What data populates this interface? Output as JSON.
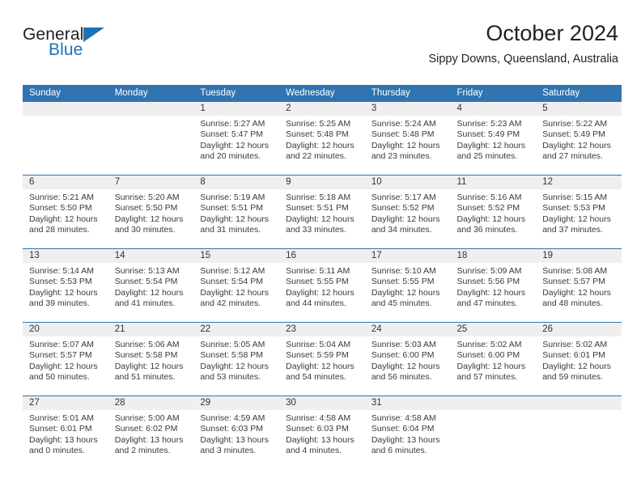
{
  "brand": {
    "line1": "General",
    "line2": "Blue",
    "triangle_color": "#1d72b8"
  },
  "header": {
    "title": "October 2024",
    "subtitle": "Sippy Downs, Queensland, Australia",
    "accent_color": "#3074b0",
    "band_color": "#efefef"
  },
  "weekday_headers": [
    "Sunday",
    "Monday",
    "Tuesday",
    "Wednesday",
    "Thursday",
    "Friday",
    "Saturday"
  ],
  "labels": {
    "sunrise_prefix": "Sunrise:",
    "sunset_prefix": "Sunset:",
    "daylight_prefix": "Daylight:"
  },
  "weeks": [
    [
      {
        "day": "",
        "sunrise": "",
        "sunset": "",
        "daylight": "",
        "empty": true
      },
      {
        "day": "",
        "sunrise": "",
        "sunset": "",
        "daylight": "",
        "empty": true
      },
      {
        "day": "1",
        "sunrise": "Sunrise: 5:27 AM",
        "sunset": "Sunset: 5:47 PM",
        "daylight": "Daylight: 12 hours and 20 minutes."
      },
      {
        "day": "2",
        "sunrise": "Sunrise: 5:25 AM",
        "sunset": "Sunset: 5:48 PM",
        "daylight": "Daylight: 12 hours and 22 minutes."
      },
      {
        "day": "3",
        "sunrise": "Sunrise: 5:24 AM",
        "sunset": "Sunset: 5:48 PM",
        "daylight": "Daylight: 12 hours and 23 minutes."
      },
      {
        "day": "4",
        "sunrise": "Sunrise: 5:23 AM",
        "sunset": "Sunset: 5:49 PM",
        "daylight": "Daylight: 12 hours and 25 minutes."
      },
      {
        "day": "5",
        "sunrise": "Sunrise: 5:22 AM",
        "sunset": "Sunset: 5:49 PM",
        "daylight": "Daylight: 12 hours and 27 minutes."
      }
    ],
    [
      {
        "day": "6",
        "sunrise": "Sunrise: 5:21 AM",
        "sunset": "Sunset: 5:50 PM",
        "daylight": "Daylight: 12 hours and 28 minutes."
      },
      {
        "day": "7",
        "sunrise": "Sunrise: 5:20 AM",
        "sunset": "Sunset: 5:50 PM",
        "daylight": "Daylight: 12 hours and 30 minutes."
      },
      {
        "day": "8",
        "sunrise": "Sunrise: 5:19 AM",
        "sunset": "Sunset: 5:51 PM",
        "daylight": "Daylight: 12 hours and 31 minutes."
      },
      {
        "day": "9",
        "sunrise": "Sunrise: 5:18 AM",
        "sunset": "Sunset: 5:51 PM",
        "daylight": "Daylight: 12 hours and 33 minutes."
      },
      {
        "day": "10",
        "sunrise": "Sunrise: 5:17 AM",
        "sunset": "Sunset: 5:52 PM",
        "daylight": "Daylight: 12 hours and 34 minutes."
      },
      {
        "day": "11",
        "sunrise": "Sunrise: 5:16 AM",
        "sunset": "Sunset: 5:52 PM",
        "daylight": "Daylight: 12 hours and 36 minutes."
      },
      {
        "day": "12",
        "sunrise": "Sunrise: 5:15 AM",
        "sunset": "Sunset: 5:53 PM",
        "daylight": "Daylight: 12 hours and 37 minutes."
      }
    ],
    [
      {
        "day": "13",
        "sunrise": "Sunrise: 5:14 AM",
        "sunset": "Sunset: 5:53 PM",
        "daylight": "Daylight: 12 hours and 39 minutes."
      },
      {
        "day": "14",
        "sunrise": "Sunrise: 5:13 AM",
        "sunset": "Sunset: 5:54 PM",
        "daylight": "Daylight: 12 hours and 41 minutes."
      },
      {
        "day": "15",
        "sunrise": "Sunrise: 5:12 AM",
        "sunset": "Sunset: 5:54 PM",
        "daylight": "Daylight: 12 hours and 42 minutes."
      },
      {
        "day": "16",
        "sunrise": "Sunrise: 5:11 AM",
        "sunset": "Sunset: 5:55 PM",
        "daylight": "Daylight: 12 hours and 44 minutes."
      },
      {
        "day": "17",
        "sunrise": "Sunrise: 5:10 AM",
        "sunset": "Sunset: 5:55 PM",
        "daylight": "Daylight: 12 hours and 45 minutes."
      },
      {
        "day": "18",
        "sunrise": "Sunrise: 5:09 AM",
        "sunset": "Sunset: 5:56 PM",
        "daylight": "Daylight: 12 hours and 47 minutes."
      },
      {
        "day": "19",
        "sunrise": "Sunrise: 5:08 AM",
        "sunset": "Sunset: 5:57 PM",
        "daylight": "Daylight: 12 hours and 48 minutes."
      }
    ],
    [
      {
        "day": "20",
        "sunrise": "Sunrise: 5:07 AM",
        "sunset": "Sunset: 5:57 PM",
        "daylight": "Daylight: 12 hours and 50 minutes."
      },
      {
        "day": "21",
        "sunrise": "Sunrise: 5:06 AM",
        "sunset": "Sunset: 5:58 PM",
        "daylight": "Daylight: 12 hours and 51 minutes."
      },
      {
        "day": "22",
        "sunrise": "Sunrise: 5:05 AM",
        "sunset": "Sunset: 5:58 PM",
        "daylight": "Daylight: 12 hours and 53 minutes."
      },
      {
        "day": "23",
        "sunrise": "Sunrise: 5:04 AM",
        "sunset": "Sunset: 5:59 PM",
        "daylight": "Daylight: 12 hours and 54 minutes."
      },
      {
        "day": "24",
        "sunrise": "Sunrise: 5:03 AM",
        "sunset": "Sunset: 6:00 PM",
        "daylight": "Daylight: 12 hours and 56 minutes."
      },
      {
        "day": "25",
        "sunrise": "Sunrise: 5:02 AM",
        "sunset": "Sunset: 6:00 PM",
        "daylight": "Daylight: 12 hours and 57 minutes."
      },
      {
        "day": "26",
        "sunrise": "Sunrise: 5:02 AM",
        "sunset": "Sunset: 6:01 PM",
        "daylight": "Daylight: 12 hours and 59 minutes."
      }
    ],
    [
      {
        "day": "27",
        "sunrise": "Sunrise: 5:01 AM",
        "sunset": "Sunset: 6:01 PM",
        "daylight": "Daylight: 13 hours and 0 minutes."
      },
      {
        "day": "28",
        "sunrise": "Sunrise: 5:00 AM",
        "sunset": "Sunset: 6:02 PM",
        "daylight": "Daylight: 13 hours and 2 minutes."
      },
      {
        "day": "29",
        "sunrise": "Sunrise: 4:59 AM",
        "sunset": "Sunset: 6:03 PM",
        "daylight": "Daylight: 13 hours and 3 minutes."
      },
      {
        "day": "30",
        "sunrise": "Sunrise: 4:58 AM",
        "sunset": "Sunset: 6:03 PM",
        "daylight": "Daylight: 13 hours and 4 minutes."
      },
      {
        "day": "31",
        "sunrise": "Sunrise: 4:58 AM",
        "sunset": "Sunset: 6:04 PM",
        "daylight": "Daylight: 13 hours and 6 minutes."
      },
      {
        "day": "",
        "sunrise": "",
        "sunset": "",
        "daylight": "",
        "empty": true
      },
      {
        "day": "",
        "sunrise": "",
        "sunset": "",
        "daylight": "",
        "empty": true
      }
    ]
  ]
}
